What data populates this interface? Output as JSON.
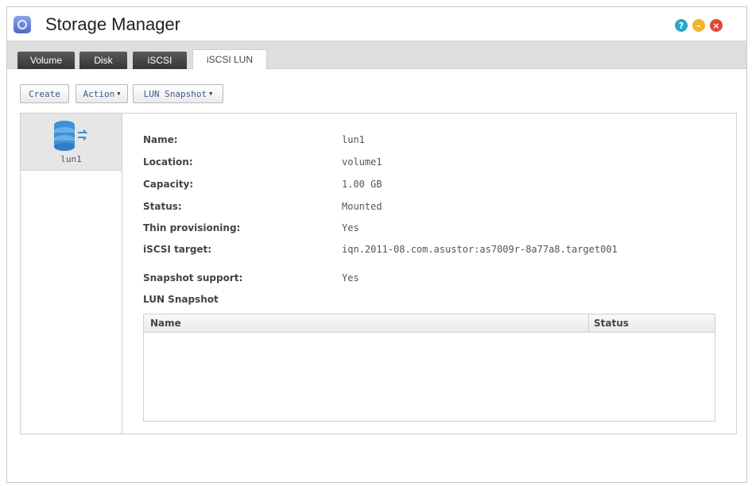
{
  "window": {
    "title": "Storage Manager"
  },
  "icons": {
    "app": "storage-manager-icon",
    "help": "help-icon",
    "minimize": "minimize-icon",
    "close": "close-icon",
    "lun": "database-lun-icon"
  },
  "colors": {
    "help": "#2aa7c9",
    "minimize": "#f3b52a",
    "close": "#e3453a",
    "lun_icon": "#3f8fd8"
  },
  "tabs": [
    {
      "label": "Volume"
    },
    {
      "label": "Disk"
    },
    {
      "label": "iSCSI"
    },
    {
      "label": "iSCSI LUN",
      "active": true
    }
  ],
  "toolbar": {
    "create_label": "Create",
    "action_label": "Action",
    "snapshot_label": "LUN Snapshot"
  },
  "lun_list": [
    {
      "label": "lun1"
    }
  ],
  "details": {
    "name_label": "Name:",
    "name_value": "lun1",
    "location_label": "Location:",
    "location_value": "volume1",
    "capacity_label": "Capacity:",
    "capacity_value": "1.00 GB",
    "status_label": "Status:",
    "status_value": "Mounted",
    "thin_label": "Thin provisioning:",
    "thin_value": "Yes",
    "target_label": "iSCSI target:",
    "target_value": "iqn.2011-08.com.asustor:as7009r-8a77a8.target001",
    "snapshot_support_label": "Snapshot support:",
    "snapshot_support_value": "Yes",
    "lun_snapshot_heading": "LUN Snapshot"
  },
  "snapshot_table": {
    "columns": [
      "Name",
      "Status"
    ],
    "rows": []
  }
}
